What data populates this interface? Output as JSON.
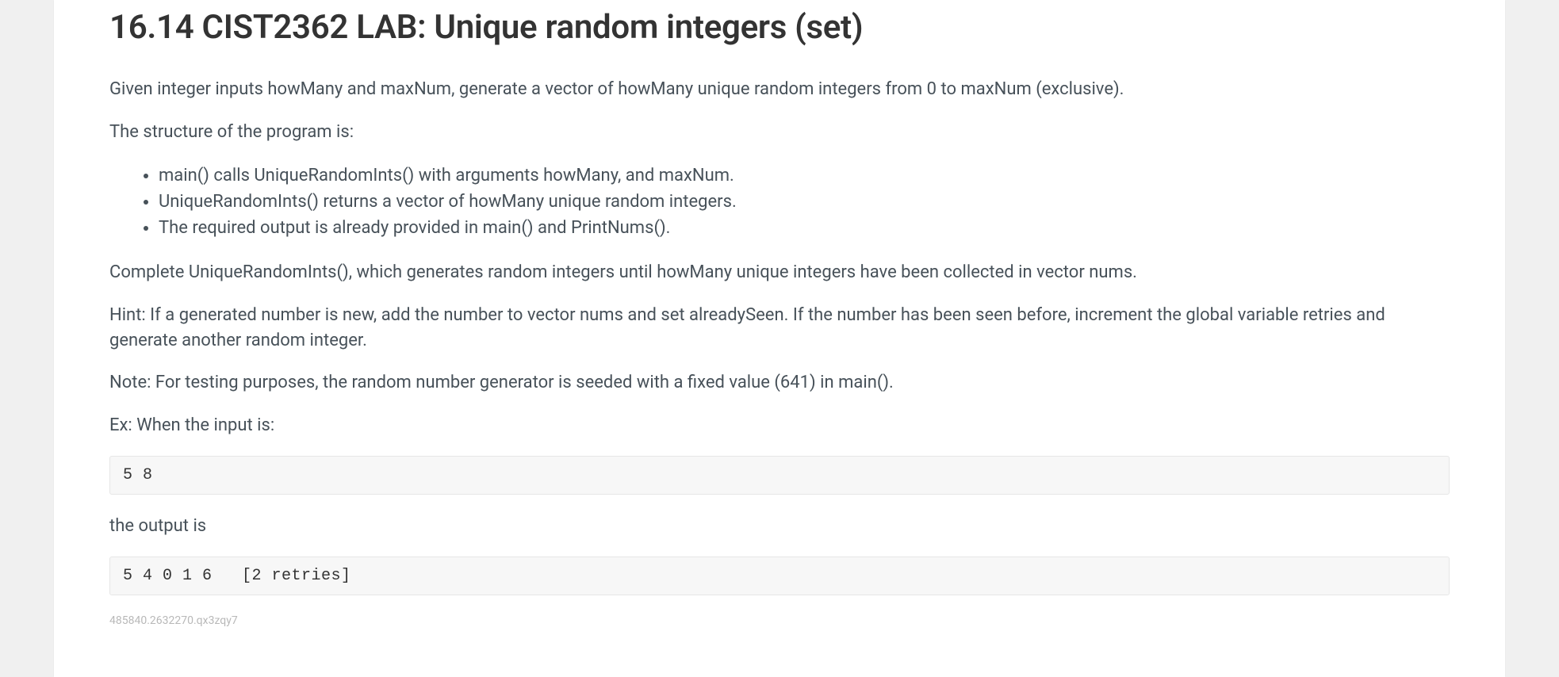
{
  "title": "16.14 CIST2362 LAB: Unique random integers (set)",
  "paragraphs": {
    "p1": "Given integer inputs howMany and maxNum, generate a vector of howMany unique random integers from 0 to maxNum (exclusive).",
    "p2": "The structure of the program is:",
    "p3": "Complete UniqueRandomInts(), which generates random integers until howMany unique integers have been collected in vector nums.",
    "p4": "Hint: If a generated number is new, add the number to vector nums and set alreadySeen. If the number has been seen before, increment the global variable retries and generate another random integer.",
    "p5": "Note: For testing purposes, the random number generator is seeded with a fixed value (641) in main().",
    "p6": "Ex: When the input is:",
    "p7": "the output is"
  },
  "bullets": {
    "b1": "main() calls UniqueRandomInts() with arguments howMany, and maxNum.",
    "b2": "UniqueRandomInts() returns a vector of howMany unique random integers.",
    "b3": "The required output is already provided in main() and PrintNums()."
  },
  "code": {
    "input": "5 8",
    "output": "5 4 0 1 6   [2 retries]"
  },
  "footerId": "485840.2632270.qx3zqy7"
}
